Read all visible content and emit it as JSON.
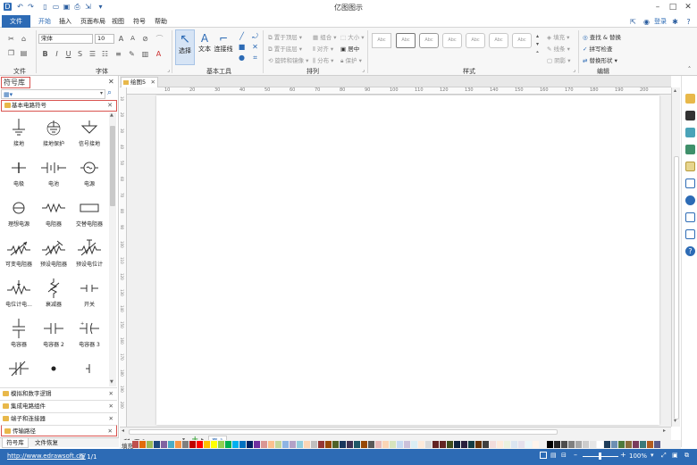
{
  "app": {
    "title": "亿图图示"
  },
  "menu": {
    "file": "文件",
    "items": [
      "开始",
      "插入",
      "页面布局",
      "视图",
      "符号",
      "帮助"
    ],
    "login": "登录"
  },
  "ribbon": {
    "groups": {
      "file": "文件",
      "font": "字体",
      "basic_tools": "基本工具",
      "arrange": "排列",
      "style": "样式",
      "edit": "编辑"
    },
    "font_name": "宋体",
    "font_size": "10",
    "tools": {
      "select": "选择",
      "text": "文本",
      "connector": "连接线"
    },
    "arrange": {
      "bring_front": "置于顶层",
      "send_back": "置于底层",
      "rotate_mirror": "旋转和镜像",
      "group": "组合",
      "align": "对齐",
      "distribute": "分布",
      "size": "大小",
      "center": "居中",
      "protect": "保护"
    },
    "style_sample": "Abc",
    "fill": "填充",
    "line": "线条",
    "shadow": "阴影",
    "find_replace": "查找 & 替换",
    "spell_check": "拼写检查",
    "replace_shape": "替换形状"
  },
  "library": {
    "title": "符号库",
    "section": "基本电路符号",
    "items": [
      "接地",
      "接地保护",
      "信号接地",
      "电极",
      "电池",
      "电源",
      "理想电源",
      "电阻器",
      "交替电阻器",
      "可变电阻器",
      "预设电阻器",
      "预设电位计",
      "电位计电...",
      "衰减器",
      "开关",
      "电容器",
      "电容器 2",
      "电容器 3"
    ],
    "collapsed": [
      "模拟和数字逻辑",
      "集成电路组件",
      "端子和连接器",
      "传输路径"
    ],
    "tabs": [
      "符号库",
      "文件恢复"
    ]
  },
  "document": {
    "tab": "绘图5",
    "page_label": "页-1",
    "page_tab": "页-1",
    "fill_label": "填充"
  },
  "ruler": {
    "top": [
      "10",
      "20",
      "30",
      "40",
      "50",
      "60",
      "70",
      "80",
      "90",
      "100",
      "110",
      "120",
      "130",
      "140",
      "150",
      "160",
      "170",
      "180",
      "190",
      "200"
    ],
    "left": [
      "10",
      "20",
      "30",
      "40",
      "50",
      "60",
      "70",
      "80",
      "90",
      "100",
      "110",
      "120",
      "130",
      "140",
      "150",
      "160",
      "170",
      "180",
      "190",
      "200"
    ]
  },
  "status": {
    "url": "http://www.edrawsoft.cn/",
    "page": "页 1/1",
    "zoom": "100%"
  },
  "colors": {
    "accent": "#2d6bb5",
    "red_outline": "#d9534f"
  }
}
